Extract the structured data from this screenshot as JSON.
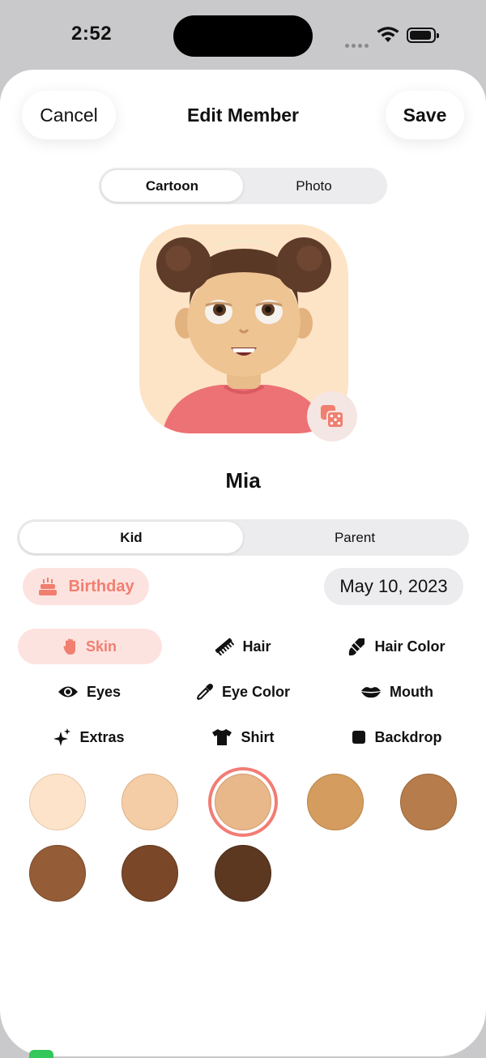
{
  "status": {
    "time": "2:52"
  },
  "nav": {
    "cancel": "Cancel",
    "title": "Edit Member",
    "save": "Save"
  },
  "mode_tabs": [
    {
      "label": "Cartoon",
      "active": true
    },
    {
      "label": "Photo",
      "active": false
    }
  ],
  "member": {
    "name": "Mia"
  },
  "role_tabs": [
    {
      "label": "Kid",
      "active": true
    },
    {
      "label": "Parent",
      "active": false
    }
  ],
  "birthday": {
    "label": "Birthday",
    "date": "May 10, 2023"
  },
  "categories": [
    {
      "label": "Skin",
      "icon": "hand-icon",
      "active": true
    },
    {
      "label": "Hair",
      "icon": "comb-icon"
    },
    {
      "label": "Hair Color",
      "icon": "paintbrush-icon"
    },
    {
      "label": "Eyes",
      "icon": "eye-icon"
    },
    {
      "label": "Eye Color",
      "icon": "eyedropper-icon"
    },
    {
      "label": "Mouth",
      "icon": "lips-icon"
    },
    {
      "label": "Extras",
      "icon": "sparkles-icon"
    },
    {
      "label": "Shirt",
      "icon": "tshirt-icon"
    },
    {
      "label": "Backdrop",
      "icon": "square-icon"
    }
  ],
  "skin_colors": [
    "#fde3c9",
    "#f4cda6",
    "#e8b78a",
    "#d49c5e",
    "#b67c4b",
    "#945d37",
    "#7a4728",
    "#5c3820"
  ],
  "selected_skin_index": 2,
  "colors": {
    "accent": "#f07f70",
    "accent_bg": "#fde3e0",
    "avatar_bg": "#fde4c6",
    "selected_ring": "#f27c74"
  }
}
